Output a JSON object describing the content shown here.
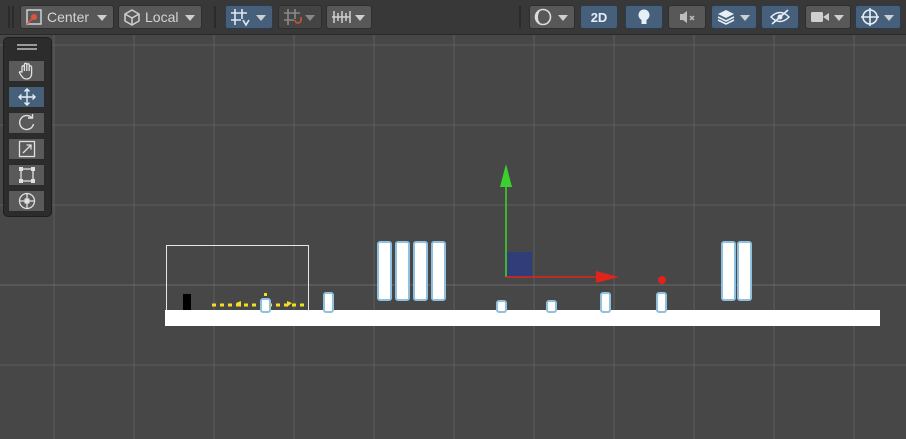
{
  "toolbar": {
    "pivot_label": "Center",
    "space_label": "Local",
    "mode_2d_label": "2D"
  },
  "tools": [
    "hand",
    "move",
    "rotate",
    "scale",
    "rect",
    "transform"
  ],
  "colors": {
    "background": "#474747",
    "toolbar": "#383838",
    "accent": "#46607c",
    "gizmo_x": "#e0231b",
    "gizmo_y": "#3cd02c",
    "platform": "#ffffff"
  }
}
